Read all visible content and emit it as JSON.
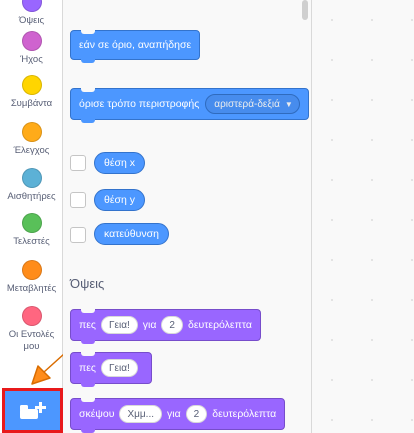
{
  "categories": [
    {
      "id": "looks",
      "label": "Όψεις",
      "color": "#9966ff"
    },
    {
      "id": "sound",
      "label": "Ήχος",
      "color": "#cf63cf"
    },
    {
      "id": "events",
      "label": "Συμβάντα",
      "color": "#ffd500"
    },
    {
      "id": "control",
      "label": "Έλεγχος",
      "color": "#ffab19"
    },
    {
      "id": "sensing",
      "label": "Αισθητήρες",
      "color": "#5cb1d6"
    },
    {
      "id": "operators",
      "label": "Τελεστές",
      "color": "#59c059"
    },
    {
      "id": "variables",
      "label": "Μεταβλητές",
      "color": "#ff8c1a"
    },
    {
      "id": "myblocks",
      "label": "Οι Εντολές μου",
      "color": "#ff6680"
    }
  ],
  "blocks": {
    "bounce": "εάν σε όριο, αναπήδησε",
    "rotation_label": "όρισε τρόπο περιστροφής",
    "rotation_value": "αριστερά-δεξιά",
    "xpos": "θέση x",
    "ypos": "θέση y",
    "direction": "κατεύθυνση"
  },
  "looks_section": {
    "title": "Όψεις",
    "say_for": {
      "pre": "πες",
      "msg": "Γεια!",
      "mid": "για",
      "secs": "2",
      "post": "δευτερόλεπτα"
    },
    "say": {
      "pre": "πες",
      "msg": "Γεια!"
    },
    "think_for": {
      "pre": "σκέψου",
      "msg": "Χμμ...",
      "mid": "για",
      "secs": "2",
      "post": "δευτερόλεπτα"
    }
  }
}
